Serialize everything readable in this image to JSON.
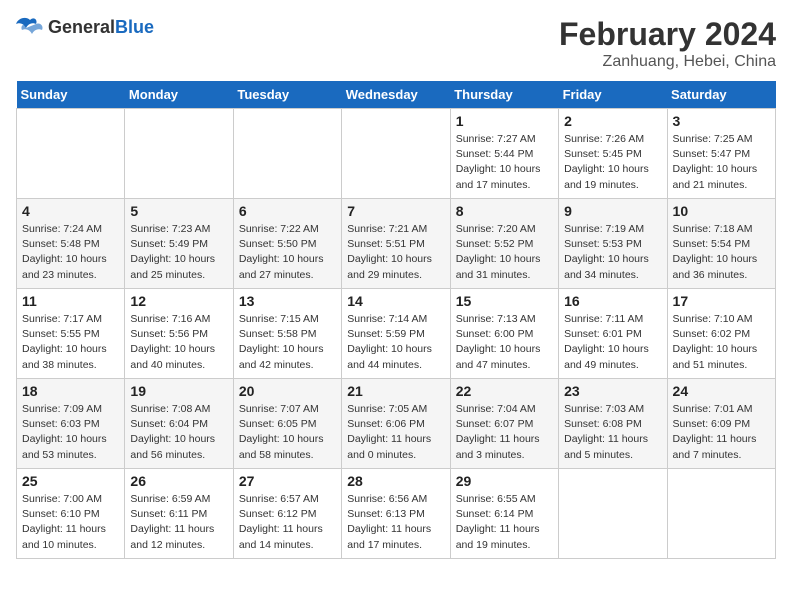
{
  "logo": {
    "general": "General",
    "blue": "Blue"
  },
  "header": {
    "title": "February 2024",
    "subtitle": "Zanhuang, Hebei, China"
  },
  "weekdays": [
    "Sunday",
    "Monday",
    "Tuesday",
    "Wednesday",
    "Thursday",
    "Friday",
    "Saturday"
  ],
  "weeks": [
    [
      {
        "day": "",
        "info": ""
      },
      {
        "day": "",
        "info": ""
      },
      {
        "day": "",
        "info": ""
      },
      {
        "day": "",
        "info": ""
      },
      {
        "day": "1",
        "info": "Sunrise: 7:27 AM\nSunset: 5:44 PM\nDaylight: 10 hours\nand 17 minutes."
      },
      {
        "day": "2",
        "info": "Sunrise: 7:26 AM\nSunset: 5:45 PM\nDaylight: 10 hours\nand 19 minutes."
      },
      {
        "day": "3",
        "info": "Sunrise: 7:25 AM\nSunset: 5:47 PM\nDaylight: 10 hours\nand 21 minutes."
      }
    ],
    [
      {
        "day": "4",
        "info": "Sunrise: 7:24 AM\nSunset: 5:48 PM\nDaylight: 10 hours\nand 23 minutes."
      },
      {
        "day": "5",
        "info": "Sunrise: 7:23 AM\nSunset: 5:49 PM\nDaylight: 10 hours\nand 25 minutes."
      },
      {
        "day": "6",
        "info": "Sunrise: 7:22 AM\nSunset: 5:50 PM\nDaylight: 10 hours\nand 27 minutes."
      },
      {
        "day": "7",
        "info": "Sunrise: 7:21 AM\nSunset: 5:51 PM\nDaylight: 10 hours\nand 29 minutes."
      },
      {
        "day": "8",
        "info": "Sunrise: 7:20 AM\nSunset: 5:52 PM\nDaylight: 10 hours\nand 31 minutes."
      },
      {
        "day": "9",
        "info": "Sunrise: 7:19 AM\nSunset: 5:53 PM\nDaylight: 10 hours\nand 34 minutes."
      },
      {
        "day": "10",
        "info": "Sunrise: 7:18 AM\nSunset: 5:54 PM\nDaylight: 10 hours\nand 36 minutes."
      }
    ],
    [
      {
        "day": "11",
        "info": "Sunrise: 7:17 AM\nSunset: 5:55 PM\nDaylight: 10 hours\nand 38 minutes."
      },
      {
        "day": "12",
        "info": "Sunrise: 7:16 AM\nSunset: 5:56 PM\nDaylight: 10 hours\nand 40 minutes."
      },
      {
        "day": "13",
        "info": "Sunrise: 7:15 AM\nSunset: 5:58 PM\nDaylight: 10 hours\nand 42 minutes."
      },
      {
        "day": "14",
        "info": "Sunrise: 7:14 AM\nSunset: 5:59 PM\nDaylight: 10 hours\nand 44 minutes."
      },
      {
        "day": "15",
        "info": "Sunrise: 7:13 AM\nSunset: 6:00 PM\nDaylight: 10 hours\nand 47 minutes."
      },
      {
        "day": "16",
        "info": "Sunrise: 7:11 AM\nSunset: 6:01 PM\nDaylight: 10 hours\nand 49 minutes."
      },
      {
        "day": "17",
        "info": "Sunrise: 7:10 AM\nSunset: 6:02 PM\nDaylight: 10 hours\nand 51 minutes."
      }
    ],
    [
      {
        "day": "18",
        "info": "Sunrise: 7:09 AM\nSunset: 6:03 PM\nDaylight: 10 hours\nand 53 minutes."
      },
      {
        "day": "19",
        "info": "Sunrise: 7:08 AM\nSunset: 6:04 PM\nDaylight: 10 hours\nand 56 minutes."
      },
      {
        "day": "20",
        "info": "Sunrise: 7:07 AM\nSunset: 6:05 PM\nDaylight: 10 hours\nand 58 minutes."
      },
      {
        "day": "21",
        "info": "Sunrise: 7:05 AM\nSunset: 6:06 PM\nDaylight: 11 hours\nand 0 minutes."
      },
      {
        "day": "22",
        "info": "Sunrise: 7:04 AM\nSunset: 6:07 PM\nDaylight: 11 hours\nand 3 minutes."
      },
      {
        "day": "23",
        "info": "Sunrise: 7:03 AM\nSunset: 6:08 PM\nDaylight: 11 hours\nand 5 minutes."
      },
      {
        "day": "24",
        "info": "Sunrise: 7:01 AM\nSunset: 6:09 PM\nDaylight: 11 hours\nand 7 minutes."
      }
    ],
    [
      {
        "day": "25",
        "info": "Sunrise: 7:00 AM\nSunset: 6:10 PM\nDaylight: 11 hours\nand 10 minutes."
      },
      {
        "day": "26",
        "info": "Sunrise: 6:59 AM\nSunset: 6:11 PM\nDaylight: 11 hours\nand 12 minutes."
      },
      {
        "day": "27",
        "info": "Sunrise: 6:57 AM\nSunset: 6:12 PM\nDaylight: 11 hours\nand 14 minutes."
      },
      {
        "day": "28",
        "info": "Sunrise: 6:56 AM\nSunset: 6:13 PM\nDaylight: 11 hours\nand 17 minutes."
      },
      {
        "day": "29",
        "info": "Sunrise: 6:55 AM\nSunset: 6:14 PM\nDaylight: 11 hours\nand 19 minutes."
      },
      {
        "day": "",
        "info": ""
      },
      {
        "day": "",
        "info": ""
      }
    ]
  ]
}
